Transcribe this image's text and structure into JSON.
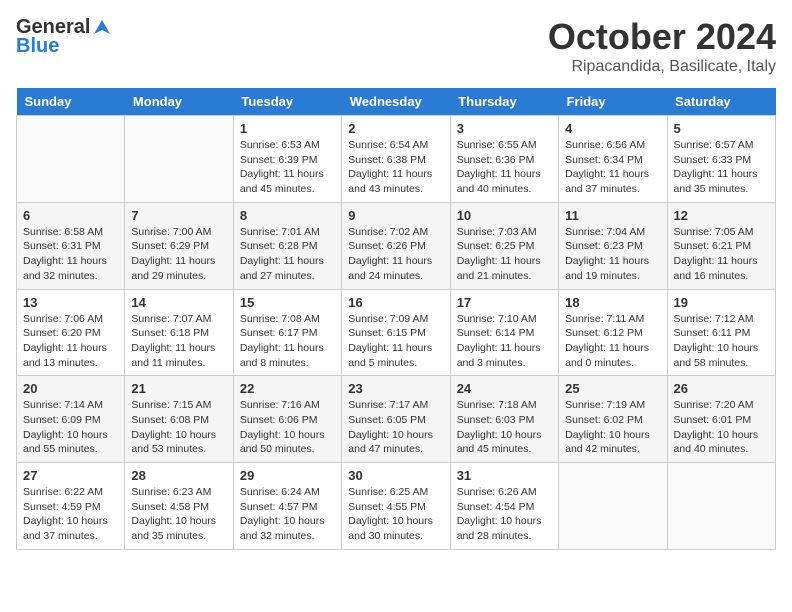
{
  "header": {
    "logo_general": "General",
    "logo_blue": "Blue",
    "month": "October 2024",
    "location": "Ripacandida, Basilicate, Italy"
  },
  "weekdays": [
    "Sunday",
    "Monday",
    "Tuesday",
    "Wednesday",
    "Thursday",
    "Friday",
    "Saturday"
  ],
  "weeks": [
    [
      {
        "day": "",
        "info": ""
      },
      {
        "day": "",
        "info": ""
      },
      {
        "day": "1",
        "info": "Sunrise: 6:53 AM\nSunset: 6:39 PM\nDaylight: 11 hours and 45 minutes."
      },
      {
        "day": "2",
        "info": "Sunrise: 6:54 AM\nSunset: 6:38 PM\nDaylight: 11 hours and 43 minutes."
      },
      {
        "day": "3",
        "info": "Sunrise: 6:55 AM\nSunset: 6:36 PM\nDaylight: 11 hours and 40 minutes."
      },
      {
        "day": "4",
        "info": "Sunrise: 6:56 AM\nSunset: 6:34 PM\nDaylight: 11 hours and 37 minutes."
      },
      {
        "day": "5",
        "info": "Sunrise: 6:57 AM\nSunset: 6:33 PM\nDaylight: 11 hours and 35 minutes."
      }
    ],
    [
      {
        "day": "6",
        "info": "Sunrise: 6:58 AM\nSunset: 6:31 PM\nDaylight: 11 hours and 32 minutes."
      },
      {
        "day": "7",
        "info": "Sunrise: 7:00 AM\nSunset: 6:29 PM\nDaylight: 11 hours and 29 minutes."
      },
      {
        "day": "8",
        "info": "Sunrise: 7:01 AM\nSunset: 6:28 PM\nDaylight: 11 hours and 27 minutes."
      },
      {
        "day": "9",
        "info": "Sunrise: 7:02 AM\nSunset: 6:26 PM\nDaylight: 11 hours and 24 minutes."
      },
      {
        "day": "10",
        "info": "Sunrise: 7:03 AM\nSunset: 6:25 PM\nDaylight: 11 hours and 21 minutes."
      },
      {
        "day": "11",
        "info": "Sunrise: 7:04 AM\nSunset: 6:23 PM\nDaylight: 11 hours and 19 minutes."
      },
      {
        "day": "12",
        "info": "Sunrise: 7:05 AM\nSunset: 6:21 PM\nDaylight: 11 hours and 16 minutes."
      }
    ],
    [
      {
        "day": "13",
        "info": "Sunrise: 7:06 AM\nSunset: 6:20 PM\nDaylight: 11 hours and 13 minutes."
      },
      {
        "day": "14",
        "info": "Sunrise: 7:07 AM\nSunset: 6:18 PM\nDaylight: 11 hours and 11 minutes."
      },
      {
        "day": "15",
        "info": "Sunrise: 7:08 AM\nSunset: 6:17 PM\nDaylight: 11 hours and 8 minutes."
      },
      {
        "day": "16",
        "info": "Sunrise: 7:09 AM\nSunset: 6:15 PM\nDaylight: 11 hours and 5 minutes."
      },
      {
        "day": "17",
        "info": "Sunrise: 7:10 AM\nSunset: 6:14 PM\nDaylight: 11 hours and 3 minutes."
      },
      {
        "day": "18",
        "info": "Sunrise: 7:11 AM\nSunset: 6:12 PM\nDaylight: 11 hours and 0 minutes."
      },
      {
        "day": "19",
        "info": "Sunrise: 7:12 AM\nSunset: 6:11 PM\nDaylight: 10 hours and 58 minutes."
      }
    ],
    [
      {
        "day": "20",
        "info": "Sunrise: 7:14 AM\nSunset: 6:09 PM\nDaylight: 10 hours and 55 minutes."
      },
      {
        "day": "21",
        "info": "Sunrise: 7:15 AM\nSunset: 6:08 PM\nDaylight: 10 hours and 53 minutes."
      },
      {
        "day": "22",
        "info": "Sunrise: 7:16 AM\nSunset: 6:06 PM\nDaylight: 10 hours and 50 minutes."
      },
      {
        "day": "23",
        "info": "Sunrise: 7:17 AM\nSunset: 6:05 PM\nDaylight: 10 hours and 47 minutes."
      },
      {
        "day": "24",
        "info": "Sunrise: 7:18 AM\nSunset: 6:03 PM\nDaylight: 10 hours and 45 minutes."
      },
      {
        "day": "25",
        "info": "Sunrise: 7:19 AM\nSunset: 6:02 PM\nDaylight: 10 hours and 42 minutes."
      },
      {
        "day": "26",
        "info": "Sunrise: 7:20 AM\nSunset: 6:01 PM\nDaylight: 10 hours and 40 minutes."
      }
    ],
    [
      {
        "day": "27",
        "info": "Sunrise: 6:22 AM\nSunset: 4:59 PM\nDaylight: 10 hours and 37 minutes."
      },
      {
        "day": "28",
        "info": "Sunrise: 6:23 AM\nSunset: 4:58 PM\nDaylight: 10 hours and 35 minutes."
      },
      {
        "day": "29",
        "info": "Sunrise: 6:24 AM\nSunset: 4:57 PM\nDaylight: 10 hours and 32 minutes."
      },
      {
        "day": "30",
        "info": "Sunrise: 6:25 AM\nSunset: 4:55 PM\nDaylight: 10 hours and 30 minutes."
      },
      {
        "day": "31",
        "info": "Sunrise: 6:26 AM\nSunset: 4:54 PM\nDaylight: 10 hours and 28 minutes."
      },
      {
        "day": "",
        "info": ""
      },
      {
        "day": "",
        "info": ""
      }
    ]
  ]
}
